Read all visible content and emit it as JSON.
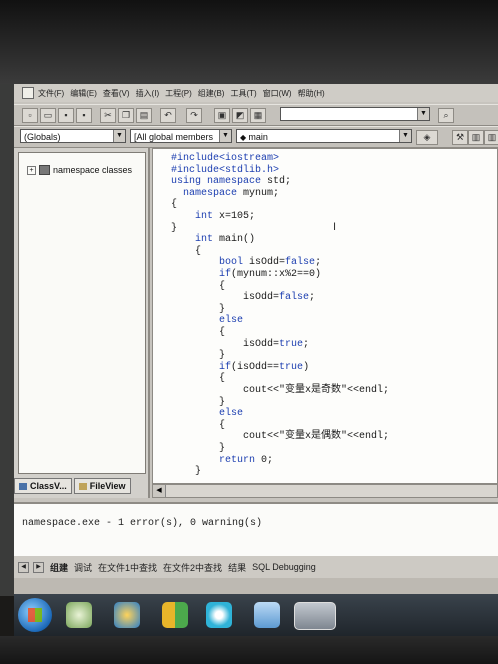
{
  "menu": {
    "items": [
      "文件(F)",
      "编辑(E)",
      "查看(V)",
      "插入(I)",
      "工程(P)",
      "组建(B)",
      "工具(T)",
      "窗口(W)",
      "帮助(H)"
    ]
  },
  "toolbar": {
    "scope_combo": "(Globals)",
    "members_combo": "[All global members",
    "function_combo": "main"
  },
  "classview": {
    "tree_item": "namespace classes",
    "tab_classview": "ClassV...",
    "tab_fileview": "FileView"
  },
  "editor": {
    "lines": [
      {
        "indent": "",
        "parts": [
          {
            "t": "#include<iostream>",
            "k": true
          }
        ]
      },
      {
        "indent": "",
        "parts": [
          {
            "t": "#include<stdlib.h>",
            "k": true
          }
        ]
      },
      {
        "indent": "",
        "parts": [
          {
            "t": "using namespace",
            "k": true
          },
          {
            "t": " std;",
            "k": false
          }
        ]
      },
      {
        "indent": "  ",
        "parts": [
          {
            "t": "namespace",
            "k": true
          },
          {
            "t": " mynum;",
            "k": false
          }
        ]
      },
      {
        "indent": "",
        "parts": [
          {
            "t": "{",
            "k": false
          }
        ]
      },
      {
        "indent": "    ",
        "parts": [
          {
            "t": "int",
            "k": true
          },
          {
            "t": " x=105;",
            "k": false
          }
        ]
      },
      {
        "indent": "",
        "parts": [
          {
            "t": "}",
            "k": false
          }
        ]
      },
      {
        "indent": "    ",
        "parts": [
          {
            "t": "int",
            "k": true
          },
          {
            "t": " main()",
            "k": false
          }
        ]
      },
      {
        "indent": "    ",
        "parts": [
          {
            "t": "{",
            "k": false
          }
        ]
      },
      {
        "indent": "        ",
        "parts": [
          {
            "t": "bool",
            "k": true
          },
          {
            "t": " isOdd=",
            "k": false
          },
          {
            "t": "false",
            "k": true
          },
          {
            "t": ";",
            "k": false
          }
        ]
      },
      {
        "indent": "        ",
        "parts": [
          {
            "t": "if",
            "k": true
          },
          {
            "t": "(mynum::x%2==0)",
            "k": false
          }
        ]
      },
      {
        "indent": "        ",
        "parts": [
          {
            "t": "{",
            "k": false
          }
        ]
      },
      {
        "indent": "            ",
        "parts": [
          {
            "t": "isOdd=",
            "k": false
          },
          {
            "t": "false",
            "k": true
          },
          {
            "t": ";",
            "k": false
          }
        ]
      },
      {
        "indent": "        ",
        "parts": [
          {
            "t": "}",
            "k": false
          }
        ]
      },
      {
        "indent": "        ",
        "parts": [
          {
            "t": "else",
            "k": true
          }
        ]
      },
      {
        "indent": "        ",
        "parts": [
          {
            "t": "{",
            "k": false
          }
        ]
      },
      {
        "indent": "            ",
        "parts": [
          {
            "t": "isOdd=",
            "k": false
          },
          {
            "t": "true",
            "k": true
          },
          {
            "t": ";",
            "k": false
          }
        ]
      },
      {
        "indent": "        ",
        "parts": [
          {
            "t": "}",
            "k": false
          }
        ]
      },
      {
        "indent": "        ",
        "parts": [
          {
            "t": "if",
            "k": true
          },
          {
            "t": "(isOdd==",
            "k": false
          },
          {
            "t": "true",
            "k": true
          },
          {
            "t": ")",
            "k": false
          }
        ]
      },
      {
        "indent": "        ",
        "parts": [
          {
            "t": "{",
            "k": false
          }
        ]
      },
      {
        "indent": "            ",
        "parts": [
          {
            "t": "cout<<\"变量x是奇数\"<<endl;",
            "k": false
          }
        ]
      },
      {
        "indent": "        ",
        "parts": [
          {
            "t": "}",
            "k": false
          }
        ]
      },
      {
        "indent": "        ",
        "parts": [
          {
            "t": "else",
            "k": true
          }
        ]
      },
      {
        "indent": "        ",
        "parts": [
          {
            "t": "{",
            "k": false
          }
        ]
      },
      {
        "indent": "            ",
        "parts": [
          {
            "t": "cout<<\"变量x是偶数\"<<endl;",
            "k": false
          }
        ]
      },
      {
        "indent": "        ",
        "parts": [
          {
            "t": "}",
            "k": false
          }
        ]
      },
      {
        "indent": "        ",
        "parts": [
          {
            "t": "return",
            "k": true
          },
          {
            "t": " 0;",
            "k": false
          }
        ]
      },
      {
        "indent": "    ",
        "parts": [
          {
            "t": "}",
            "k": false
          }
        ]
      }
    ]
  },
  "output": {
    "message": "namespace.exe - 1 error(s), 0 warning(s)",
    "tabs": [
      "组建",
      "调试",
      "在文件1中查找",
      "在文件2中查找",
      "结果",
      "SQL Debugging"
    ],
    "active_tab": "组建"
  },
  "taskbar": {
    "icons": [
      "windows-start-icon",
      "media-icon",
      "browser-icon",
      "tiles-app-icon",
      "media-player-icon",
      "bird-app-icon",
      "visual-studio-icon"
    ]
  },
  "colors": {
    "keyword": "#1c3eb0",
    "editor_bg": "#fdfdfb",
    "chrome": "#c7c4be"
  }
}
